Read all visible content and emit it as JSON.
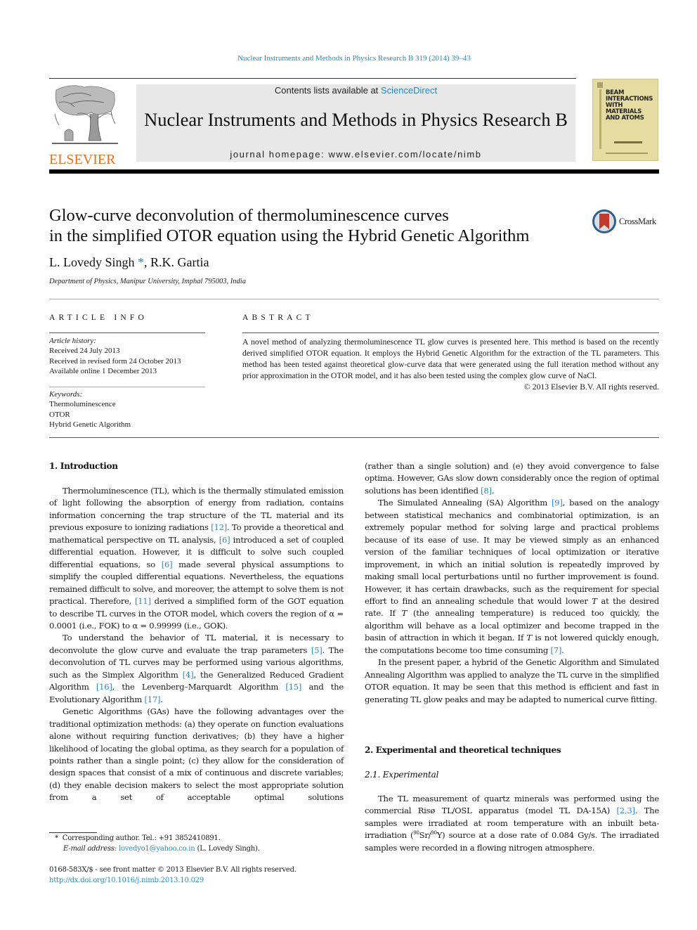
{
  "header": {
    "running_head": "Nuclear Instruments and Methods in Physics Research B 319 (2014) 39–43",
    "publisher_logo_text": "ELSEVIER",
    "contents_prefix": "Contents lists available at ",
    "contents_link": "ScienceDirect",
    "journal_name": "Nuclear Instruments and Methods in Physics Research B",
    "homepage": "journal homepage: www.elsevier.com/locate/nimb",
    "cover_title_lines": [
      "BEAM",
      "INTERACTIONS",
      "WITH",
      "MATERIALS",
      "AND ATOMS"
    ]
  },
  "article": {
    "title_line1": "Glow-curve deconvolution of thermoluminescence curves",
    "title_line2": "in the simplified OTOR equation using the Hybrid Genetic Algorithm",
    "crossmark_label": "CrossMark",
    "author1": "L. Lovedy Singh",
    "author1_mark": "*",
    "author_sep": ", ",
    "author2": "R.K. Gartia",
    "affiliation": "Department of Physics, Manipur University, Imphal 795003, India"
  },
  "article_info": {
    "heading": "ARTICLE INFO",
    "history_label": "Article history:",
    "history": [
      "Received 24 July 2013",
      "Received in revised form 24 October 2013",
      "Available online 1 December 2013"
    ],
    "keywords_label": "Keywords:",
    "keywords": [
      "Thermoluminescence",
      "OTOR",
      "Hybrid Genetic Algorithm"
    ]
  },
  "abstract": {
    "heading": "ABSTRACT",
    "text": "A novel method of analyzing thermoluminescence TL glow curves is presented here. This method is based on the recently derived simplified OTOR equation. It employs the Hybrid Genetic Algorithm for the extraction of the TL parameters. This method has been tested against theoretical glow-curve data that were generated using the full iteration method without any prior approximation in the OTOR model, and it has also been tested using the complex glow curve of NaCl.",
    "copyright": "© 2013 Elsevier B.V. All rights reserved."
  },
  "body": {
    "section1_heading": "1. Introduction",
    "p1": {
      "a": "Thermoluminescence (TL), which is the thermally stimulated emission of light following the absorption of energy from radiation, contains information concerning the trap structure of the TL material and its previous exposure to ionizing radiations ",
      "ref1": "[12]",
      "b": ". To provide a theoretical and mathematical perspective on TL analysis, ",
      "ref2": "[6]",
      "c": " introduced a set of coupled differential equation. However, it is difficult to solve such coupled differential equations, so ",
      "ref3": "[6]",
      "d": " made several physical assumptions to simplify the coupled differential equations. Nevertheless, the equations remained difficult to solve, and moreover, the attempt to solve them is not practical. Therefore, ",
      "ref4": "[11]",
      "e": " derived a simplified form of the GOT equation to describe TL curves in the OTOR model, which covers the region of α = 0.0001 (i.e., FOK) to α = 0.99999 (i.e., GOK)."
    },
    "p2": {
      "a": "To understand the behavior of TL material, it is necessary to deconvolute the glow curve and evaluate the trap parameters ",
      "ref1": "[5]",
      "b": ". The deconvolution of TL curves may be performed using various algorithms, such as the Simplex Algorithm ",
      "ref2": "[4]",
      "c": ", the Generalized Reduced Gradient Algorithm ",
      "ref3": "[16]",
      "d": ", the Levenberg–Marquardt Algorithm ",
      "ref4": "[15]",
      "e": " and the Evolutionary Algorithm ",
      "ref5": "[17]",
      "f": "."
    },
    "p3": "Genetic Algorithms (GAs) have the following advantages over the traditional optimization methods: (a) they operate on function evaluations alone without requiring function derivatives; (b) they have a higher likelihood of locating the global optima, as they search for a population of points rather than a single point; (c) they allow for the consideration of design spaces that consist of a mix of continuous and discrete variables; (d) they enable decision makers to select the most appropriate solution from a set of acceptable optimal solutions",
    "p3_cont": {
      "a": "(rather than a single solution) and (e) they avoid convergence to false optima. However, GAs slow down considerably once the region of optimal solutions has been identified ",
      "ref1": "[8]",
      "b": "."
    },
    "p4": {
      "a": "The Simulated Annealing (SA) Algorithm ",
      "ref1": "[9]",
      "b": ", based on the analogy between statistical mechanics and combinatorial optimization, is an extremely popular method for solving large and practical problems because of its ease of use. It may be viewed simply as an enhanced version of the familiar techniques of local optimization or iterative improvement, in which an initial solution is repeatedly improved by making small local perturbations until no further improvement is found. However, it has certain drawbacks, such as the requirement for special effort to find an annealing schedule that would lower ",
      "T1": "T",
      "c": " at the desired rate. If ",
      "T2": "T",
      "d": " (the annealing temperature) is reduced too quickly, the algorithm will behave as a local optimizer and become trapped in the basin of attraction in which it began. If ",
      "T3": "T",
      "e": " is not lowered quickly enough, the computations become too time consuming ",
      "ref2": "[7]",
      "f": "."
    },
    "p5": "In the present paper, a hybrid of the Genetic Algorithm and Simulated Annealing Algorithm was applied to analyze the TL curve in the simplified OTOR equation. It may be seen that this method is efficient and fast in generating TL glow peaks and may be adapted to numerical curve fitting.",
    "section2_heading": "2. Experimental and theoretical techniques",
    "subsection21_heading": "2.1. Experimental",
    "p6": {
      "a": "The TL measurement of quartz minerals was performed using the commercial Risø TL/OSL apparatus (model TL DA-15A) ",
      "ref1": "[2,3]",
      "b": ". The samples were irradiated at room temperature with an inbuilt beta-irradiation (",
      "sup1": "90",
      "c": "Sr/",
      "sup2": "90",
      "d": "Y) source at a dose rate of 0.084 Gy/s. The irradiated samples were recorded in a flowing nitrogen atmosphere."
    }
  },
  "footnotes": {
    "star": "*",
    "corresponding": "Corresponding author. Tel.: +91 3852410891.",
    "email_label": "E-mail address: ",
    "email": "lovedyo1@yahoo.co.in",
    "email_suffix": " (L. Lovedy Singh).",
    "issn_line": "0168-583X/$ - see front matter © 2013 Elsevier B.V. All rights reserved.",
    "doi": "http://dx.doi.org/10.1016/j.nimb.2013.10.029"
  },
  "colors": {
    "link": "#2a8bbf",
    "elsevier_orange": "#e8711f",
    "masthead_gray": "#e8e8e8",
    "cover_yellow": "#e4dca0",
    "crossmark_red": "#c0392b",
    "crossmark_blue": "#2f5f8a"
  }
}
